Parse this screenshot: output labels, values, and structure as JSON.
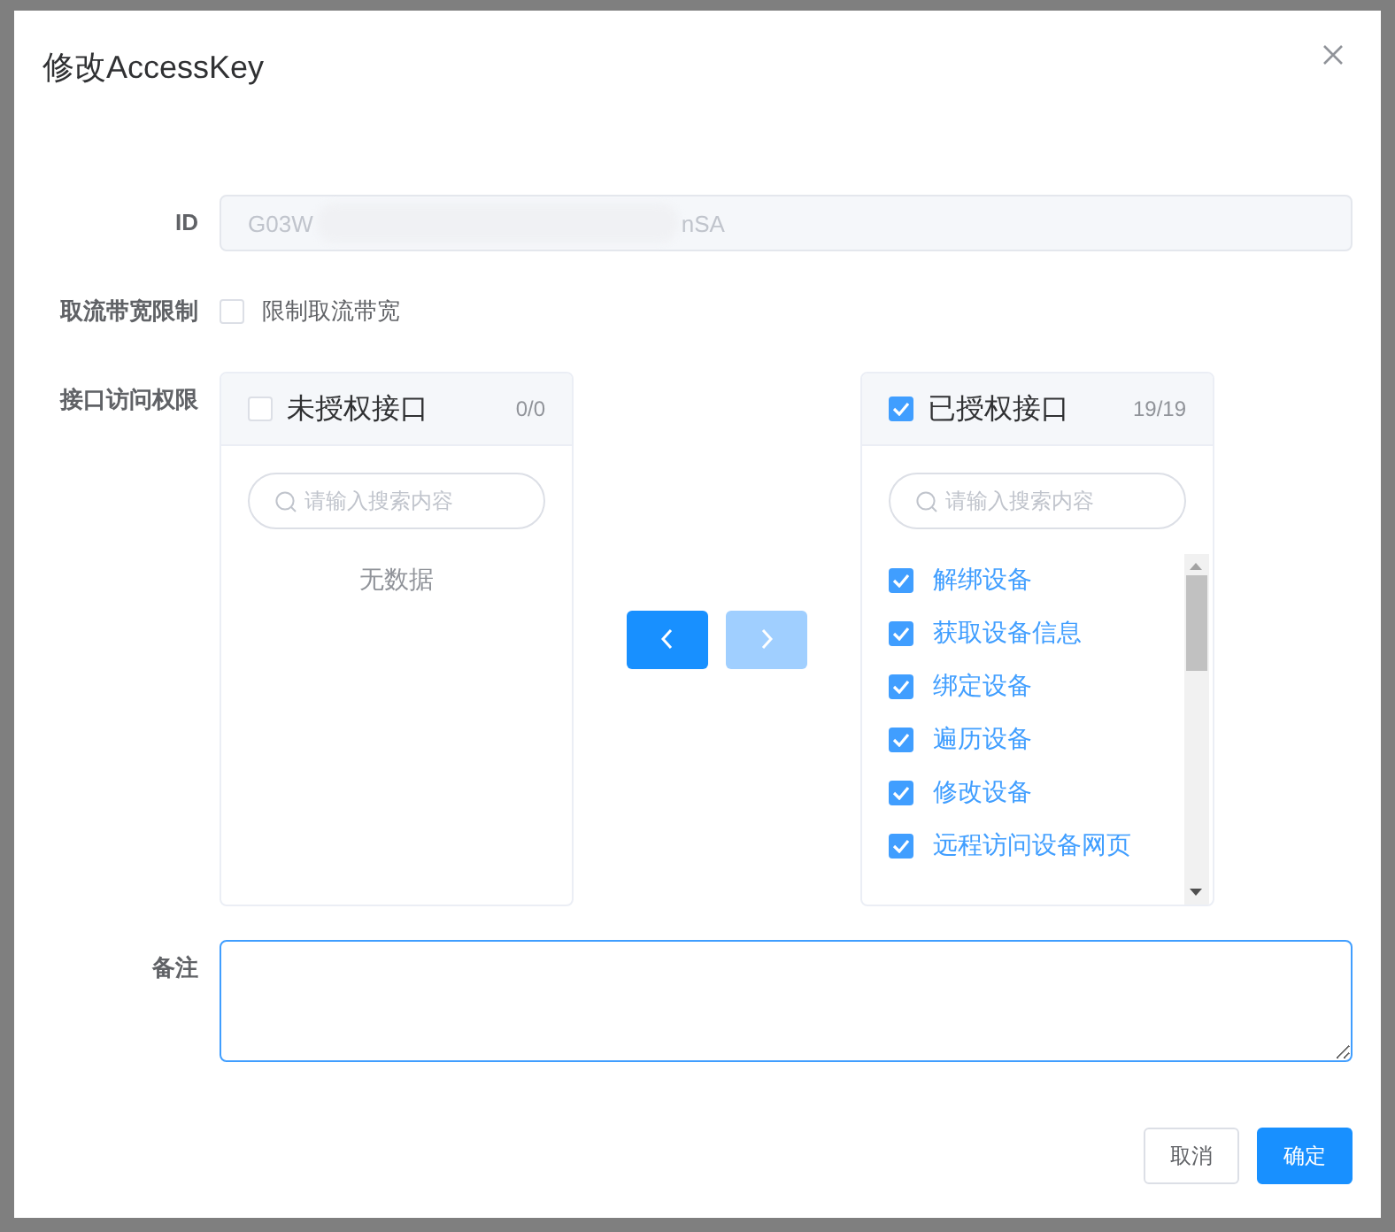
{
  "dialog": {
    "title": "修改AccessKey"
  },
  "id_field": {
    "label": "ID",
    "value_start": "G03W",
    "value_end": "nSA",
    "redacted": true,
    "disabled": true
  },
  "bandwidth": {
    "label": "取流带宽限制",
    "option": "限制取流带宽",
    "checked": false
  },
  "transfer": {
    "label": "接口访问权限",
    "panels": [
      {
        "title": "未授权接口",
        "count": "0/0",
        "checked": false,
        "placeholder": "请输入搜索内容",
        "empty_text": "无数据"
      },
      {
        "title": "已授权接口",
        "count": "19/19",
        "checked": true,
        "placeholder": "请输入搜索内容",
        "items": [
          {
            "label": "解绑设备",
            "checked": true
          },
          {
            "label": "获取设备信息",
            "checked": true
          },
          {
            "label": "绑定设备",
            "checked": true
          },
          {
            "label": "遍历设备",
            "checked": true
          },
          {
            "label": "修改设备",
            "checked": true
          },
          {
            "label": "远程访问设备网页",
            "checked": true
          }
        ]
      }
    ],
    "buttons": [
      {
        "kind": "left",
        "disabled": false
      },
      {
        "kind": "right",
        "disabled": true
      }
    ]
  },
  "remark": {
    "label": "备注",
    "focused": true
  },
  "buttons": [
    {
      "label": "取消",
      "kind": "default"
    },
    {
      "label": "确定",
      "kind": "primary"
    }
  ]
}
